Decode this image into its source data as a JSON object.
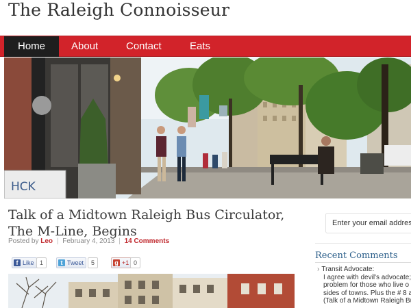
{
  "site": {
    "title": "The Raleigh Connoisseur"
  },
  "nav": {
    "items": [
      {
        "label": "Home",
        "active": true
      },
      {
        "label": "About"
      },
      {
        "label": "Contact"
      },
      {
        "label": "Eats"
      }
    ],
    "bar_color": "#d2232a",
    "active_color": "#1e1e1e"
  },
  "hero": {
    "sign_text": "HCK"
  },
  "post": {
    "title": "Talk of a Midtown Raleigh Bus Circulator, The M-Line, Begins",
    "posted_by_label": "Posted by",
    "author": "Leo",
    "date": "February 4, 2013",
    "comments": "14 Comments",
    "separator": "|"
  },
  "share": {
    "facebook": {
      "label": "Like",
      "count": "1",
      "icon": "facebook-icon"
    },
    "twitter": {
      "label": "Tweet",
      "count": "5",
      "icon": "twitter-icon"
    },
    "google": {
      "label": "+1",
      "count": "0",
      "icon": "google-plus-icon"
    }
  },
  "sidebar": {
    "email_placeholder": "Enter your email address",
    "recent_comments_heading": "Recent Comments",
    "recent_comment_lines": [
      "Transit Advocate:",
      "I agree with devil's advocate;",
      "problem for those who live o",
      "sides of towns. Plus the # 8 a",
      "(Talk of a Midtown Raleigh Bu"
    ]
  }
}
